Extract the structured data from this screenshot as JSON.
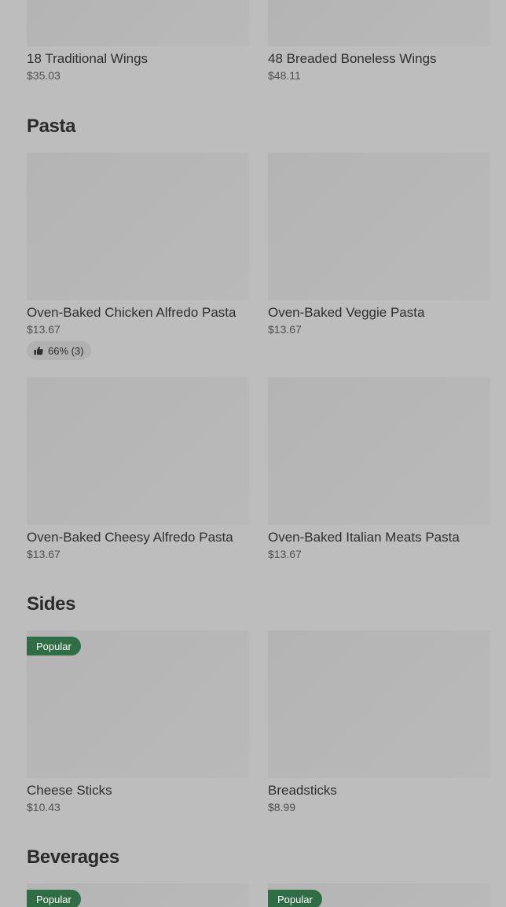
{
  "wings": {
    "items": [
      {
        "name": "18 Traditional Wings",
        "price": "$35.03"
      },
      {
        "name": "48 Breaded Boneless Wings",
        "price": "$48.11"
      }
    ]
  },
  "pasta": {
    "title": "Pasta",
    "items": [
      {
        "name": "Oven-Baked Chicken Alfredo Pasta",
        "price": "$13.67",
        "rating": "66% (3)"
      },
      {
        "name": "Oven-Baked Veggie Pasta",
        "price": "$13.67"
      },
      {
        "name": "Oven-Baked Cheesy Alfredo Pasta",
        "price": "$13.67"
      },
      {
        "name": "Oven-Baked Italian Meats Pasta",
        "price": "$13.67"
      }
    ]
  },
  "sides": {
    "title": "Sides",
    "items": [
      {
        "name": "Cheese Sticks",
        "price": "$10.43",
        "badge": "Popular"
      },
      {
        "name": "Breadsticks",
        "price": "$8.99"
      }
    ]
  },
  "beverages": {
    "title": "Beverages",
    "items": [
      {
        "badge": "Popular"
      },
      {
        "badge": "Popular"
      }
    ]
  },
  "colors": {
    "background": "#bdbdbd",
    "badge": "#2f6d45",
    "rating_pill": "#b1b1b1"
  },
  "icons": [
    "thumbs-up-icon"
  ]
}
